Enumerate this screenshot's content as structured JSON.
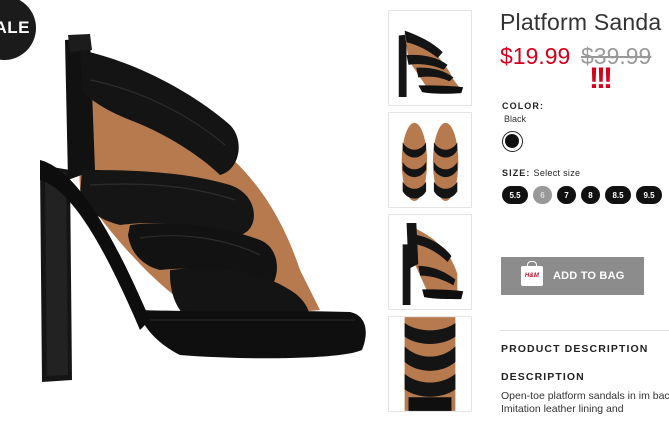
{
  "badge": {
    "text": "ALE"
  },
  "product": {
    "title": "Platform Sanda",
    "price_current": "$19.99",
    "price_original": "$39.99",
    "emphasis": "!!!"
  },
  "color": {
    "label": "COLOR:",
    "value": "Black",
    "swatches": [
      {
        "name": "Black",
        "hex": "#111111",
        "selected": true
      }
    ]
  },
  "size": {
    "label": "SIZE:",
    "hint": "Select size",
    "options": [
      {
        "label": "5.5",
        "available": true
      },
      {
        "label": "6",
        "available": false
      },
      {
        "label": "7",
        "available": true
      },
      {
        "label": "8",
        "available": true
      },
      {
        "label": "8.5",
        "available": true
      },
      {
        "label": "9.5",
        "available": true
      }
    ]
  },
  "cart": {
    "button_label": "ADD TO BAG",
    "icon_text": "H&M"
  },
  "sections": {
    "product_description": "PRODUCT DESCRIPTION",
    "description": "DESCRIPTION",
    "description_text": "Open-toe platform sandals in im back. Imitation leather lining and"
  },
  "colors": {
    "sale_red": "#d6001c",
    "button_gray": "#8c8c8c",
    "badge_black": "#1b1b1b"
  },
  "thumbnails": [
    {
      "view": "side"
    },
    {
      "view": "pair-top"
    },
    {
      "view": "back"
    },
    {
      "view": "top-detail"
    }
  ]
}
